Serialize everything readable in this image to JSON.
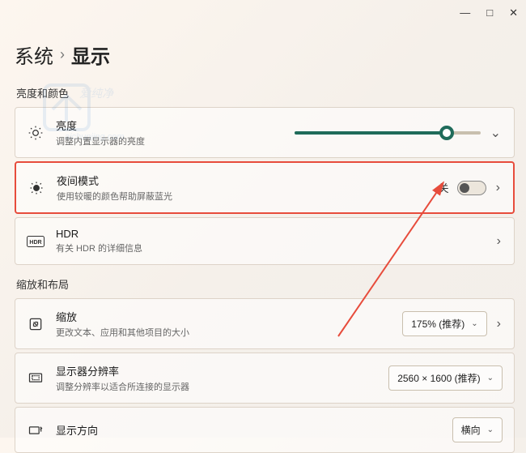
{
  "window": {
    "minimize": "—",
    "maximize": "□",
    "close": "✕"
  },
  "breadcrumb": {
    "root": "系统",
    "sep": "›",
    "current": "显示"
  },
  "sections": {
    "brightness": "亮度和颜色",
    "scale": "缩放和布局"
  },
  "brightness": {
    "title": "亮度",
    "sub": "调整内置显示器的亮度",
    "slider_percent": 82
  },
  "night": {
    "title": "夜间模式",
    "sub": "使用较暖的颜色帮助屏蔽蓝光",
    "state_label": "关",
    "state": false
  },
  "hdr": {
    "title": "HDR",
    "sub": "有关 HDR 的详细信息",
    "badge": "HDR"
  },
  "scale": {
    "title": "缩放",
    "sub": "更改文本、应用和其他项目的大小",
    "value": "175% (推荐)"
  },
  "resolution": {
    "title": "显示器分辨率",
    "sub": "调整分辨率以适合所连接的显示器",
    "value": "2560 × 1600 (推荐)"
  },
  "orientation": {
    "title": "显示方向",
    "value": "横向"
  },
  "watermark": {
    "text1": "爱纯净",
    "text2": "aichunjing.com"
  }
}
